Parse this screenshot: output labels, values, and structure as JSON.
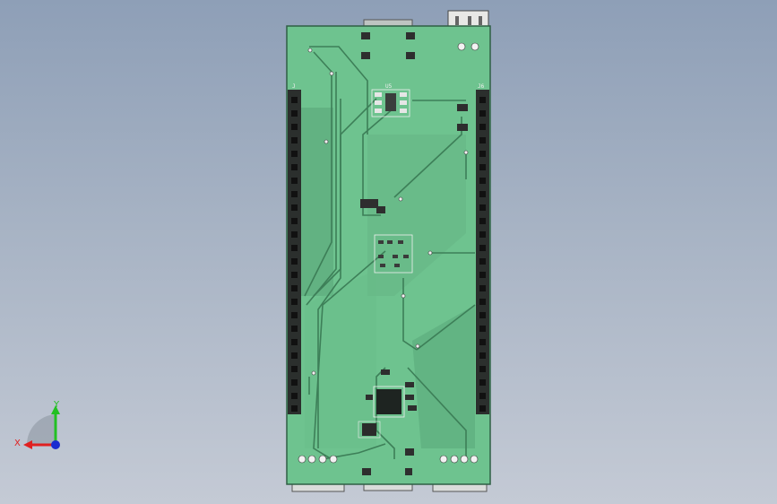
{
  "viewport": {
    "background": "#a7b3c4",
    "board_color": "#6ec38f",
    "copper_color": "#5aa77a",
    "header_color": "#2b2f2d"
  },
  "board": {
    "labels": {
      "j_left": "J",
      "j_right": "J6",
      "u_top": "U5"
    }
  },
  "triad": {
    "x_label": "X",
    "y_label": "Y",
    "x_color": "#e02020",
    "y_color": "#22c022",
    "z_color": "#1a2bd0"
  }
}
